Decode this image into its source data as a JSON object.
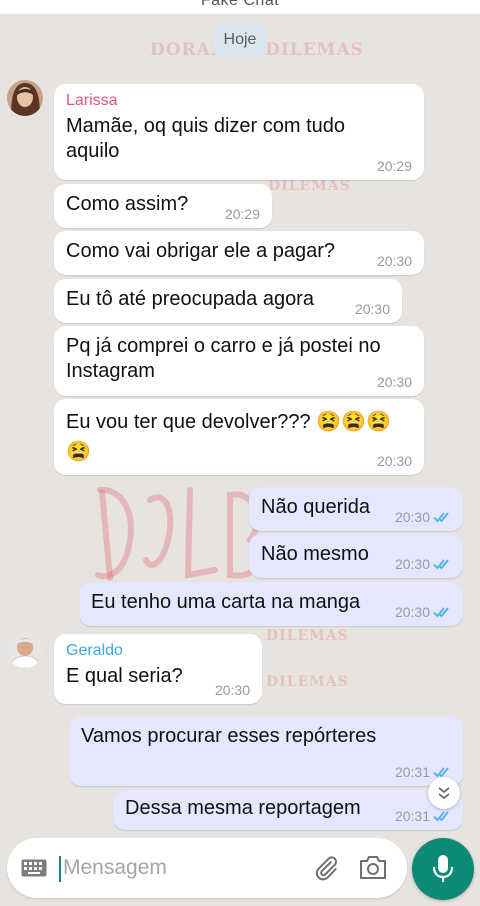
{
  "header": {
    "title": "Fake Chat"
  },
  "watermark": {
    "text_top": "DORAMAS DILEMAS",
    "text_small": "DILEMAS",
    "color": "#dc465a"
  },
  "date_divider": "Hoje",
  "contacts": {
    "larissa": {
      "name": "Larissa",
      "color": "#e8557a"
    },
    "geraldo": {
      "name": "Geraldo",
      "color": "#3ba9e0"
    }
  },
  "messages": [
    {
      "side": "in",
      "sender": "Larissa",
      "text": "Mamãe, oq quis dizer com tudo aquilo",
      "time": "20:29"
    },
    {
      "side": "in",
      "text": "Como assim?",
      "time": "20:29"
    },
    {
      "side": "in",
      "text": "Como vai obrigar ele a pagar?",
      "time": "20:30"
    },
    {
      "side": "in",
      "text": "Eu tô até preocupada agora",
      "time": "20:30"
    },
    {
      "side": "in",
      "text": "Pq já comprei o carro e já postei no Instagram",
      "time": "20:30"
    },
    {
      "side": "in",
      "text": "Eu vou ter que devolver??? 😫😫😫 😫",
      "time": "20:30"
    },
    {
      "side": "out",
      "text": "Não querida",
      "time": "20:30",
      "status": "read"
    },
    {
      "side": "out",
      "text": "Não mesmo",
      "time": "20:30",
      "status": "read"
    },
    {
      "side": "out",
      "text": "Eu tenho uma carta na manga",
      "time": "20:30",
      "status": "read"
    },
    {
      "side": "in",
      "sender": "Geraldo",
      "text": "E qual seria?",
      "time": "20:30"
    },
    {
      "side": "out",
      "text": "Vamos procurar esses repórteres",
      "time": "20:31",
      "status": "read"
    },
    {
      "side": "out",
      "text": "Dessa mesma reportagem",
      "time": "20:31",
      "status": "read"
    }
  ],
  "composer": {
    "placeholder": "Mensagem"
  },
  "icons": {
    "keyboard": "keyboard-icon",
    "attach": "paperclip-icon",
    "camera": "camera-icon",
    "mic": "microphone-icon",
    "scroll": "double-chevron-down-icon",
    "read": "double-check-icon"
  },
  "colors": {
    "accent": "#0c8a75",
    "read_tick": "#4fb3e8",
    "outgoing_bubble": "#e4e7ff",
    "background": "#e7e3de"
  }
}
